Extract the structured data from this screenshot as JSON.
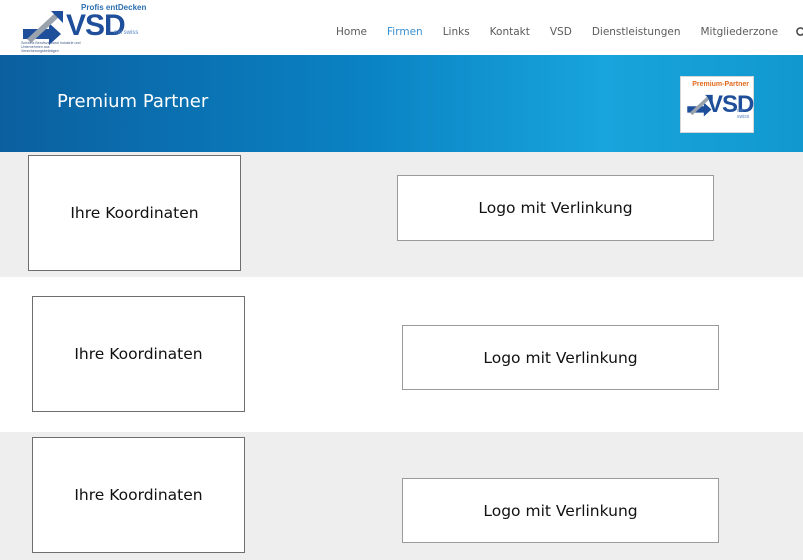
{
  "header": {
    "logo": {
      "tagline": "Profis entDecken",
      "brand": "VSD",
      "brand_sub": "mit swiss",
      "description": "Schweiz Berufsverband Industrie und Unternehmen aus Versicherungsbeiträgen"
    },
    "nav": [
      {
        "label": "Home",
        "active": false
      },
      {
        "label": "Firmen",
        "active": true
      },
      {
        "label": "Links",
        "active": false
      },
      {
        "label": "Kontakt",
        "active": false
      },
      {
        "label": "VSD",
        "active": false
      },
      {
        "label": "Dienstleistungen",
        "active": false
      },
      {
        "label": "Mitgliederzone",
        "active": false
      }
    ],
    "search_icon": "search-icon"
  },
  "banner": {
    "title": "Premium Partner",
    "badge": {
      "top": "Premium-Partner",
      "brand": "VSD",
      "brand_sub": "mit swiss"
    }
  },
  "rows": [
    {
      "coordinates_label": "Ihre Koordinaten",
      "logo_label": "Logo mit Verlinkung"
    },
    {
      "coordinates_label": "Ihre Koordinaten",
      "logo_label": "Logo mit Verlinkung"
    },
    {
      "coordinates_label": "Ihre Koordinaten",
      "logo_label": "Logo mit Verlinkung"
    }
  ],
  "colors": {
    "banner_start": "#0b5f9f",
    "banner_end": "#18a4dc",
    "nav_active": "#3a8fd0",
    "row_grey": "#eeeeee"
  }
}
